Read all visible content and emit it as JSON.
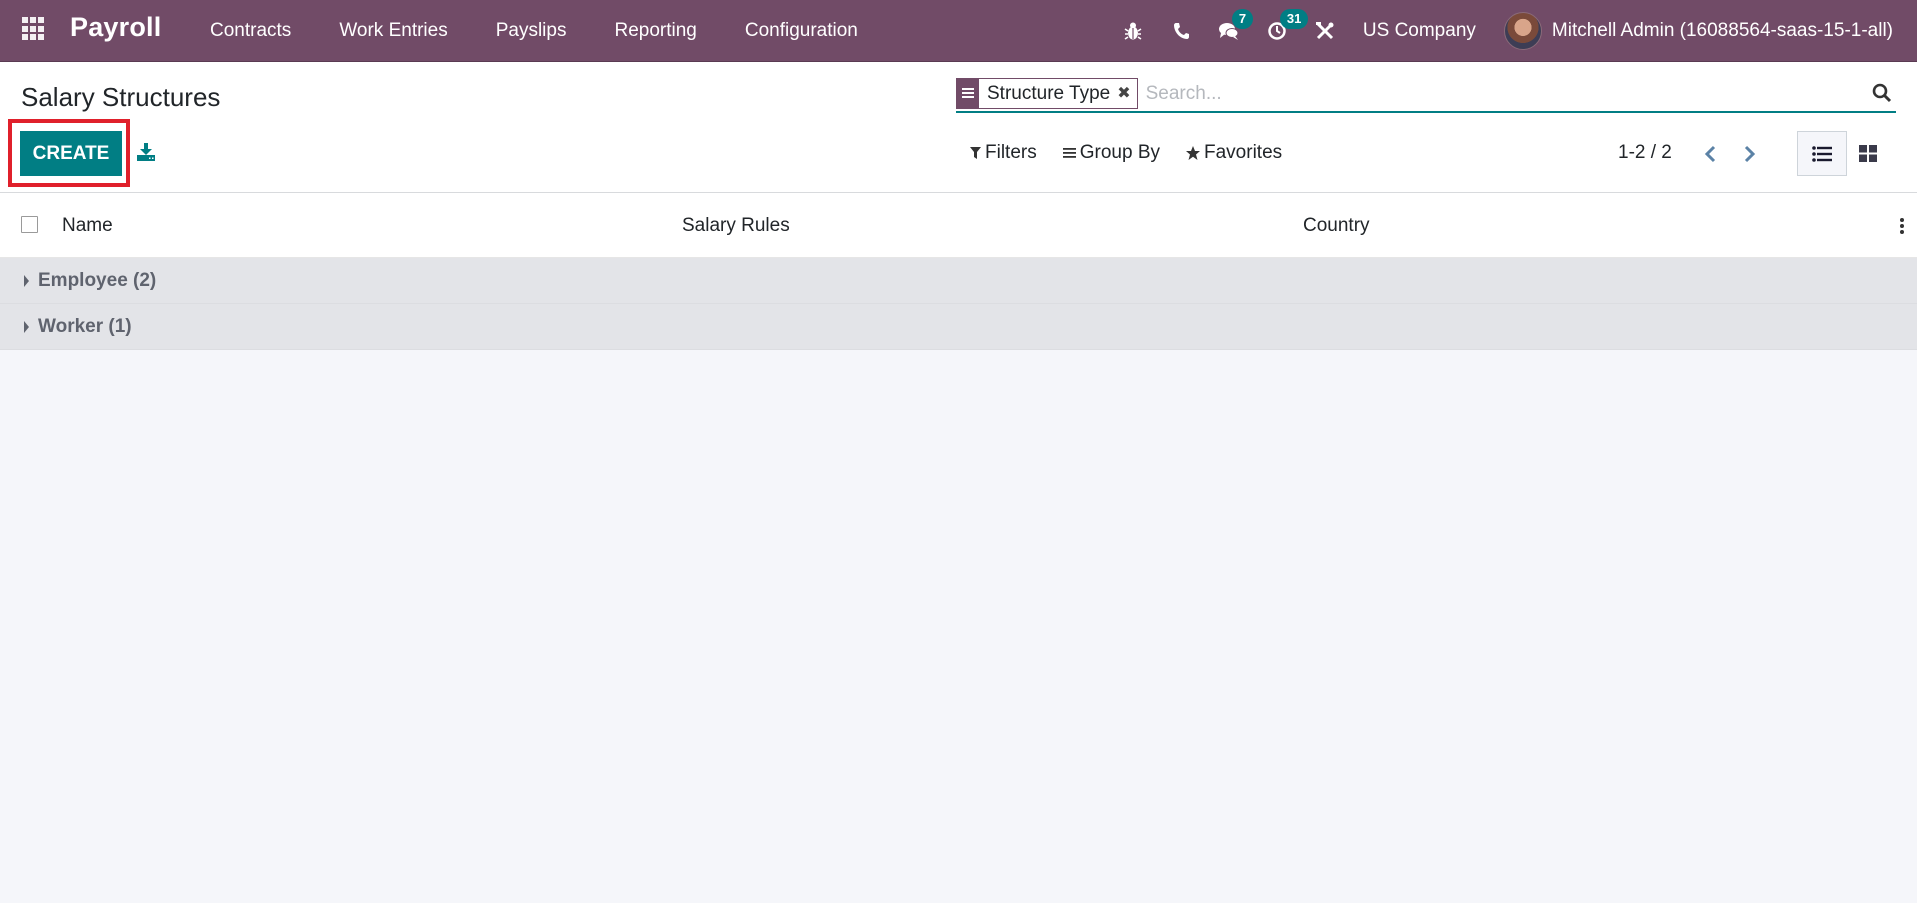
{
  "navbar": {
    "app_name": "Payroll",
    "menu": [
      {
        "label": "Contracts"
      },
      {
        "label": "Work Entries"
      },
      {
        "label": "Payslips"
      },
      {
        "label": "Reporting"
      },
      {
        "label": "Configuration"
      }
    ],
    "systray": {
      "debug_icon": "bug-icon",
      "phone_icon": "phone-icon",
      "messages_icon": "comments-icon",
      "messages_count": "7",
      "activities_icon": "clock-icon",
      "activities_count": "31",
      "settings_icon": "tools-icon",
      "company": "US Company",
      "user_name": "Mitchell Admin (16088564-saas-15-1-all)"
    },
    "colors": {
      "brand": "#714b67",
      "badge": "#017e84"
    }
  },
  "control_panel": {
    "title": "Salary Structures",
    "create_label": "CREATE",
    "search": {
      "facet": "Structure Type",
      "placeholder": "Search..."
    },
    "filters_label": "Filters",
    "group_by_label": "Group By",
    "favorites_label": "Favorites",
    "pager": "1-2 / 2",
    "colors": {
      "primary": "#017e84",
      "highlight": "#e0202b"
    }
  },
  "list": {
    "columns": [
      {
        "label": "Name"
      },
      {
        "label": "Salary Rules"
      },
      {
        "label": "Country"
      }
    ],
    "groups": [
      {
        "label": "Employee (2)"
      },
      {
        "label": "Worker (1)"
      }
    ]
  }
}
